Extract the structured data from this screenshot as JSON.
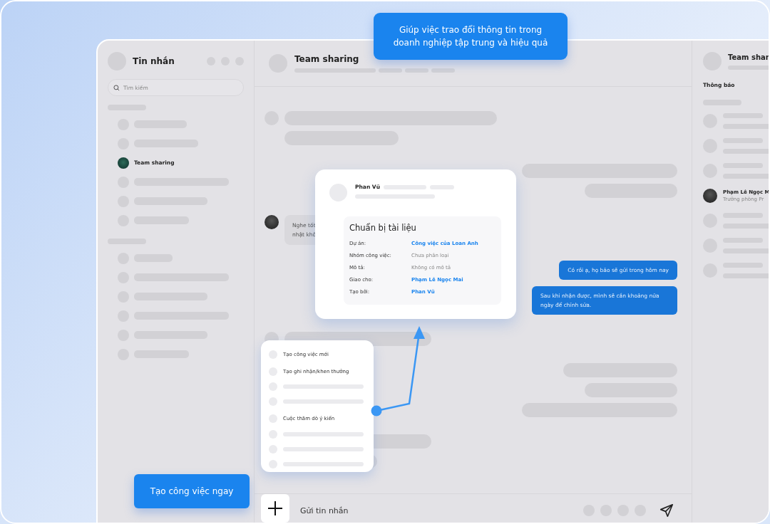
{
  "callout": "Giúp việc trao đổi thông tin trong doanh nghiệp tập trung và hiệu quả",
  "cta_button": "Tạo công việc ngay",
  "sidebar": {
    "title": "Tin nhắn",
    "search": {
      "placeholder": "Tìm kiếm"
    },
    "sections": [
      {
        "items": [
          {
            "kind": "placeholder"
          },
          {
            "kind": "placeholder"
          },
          {
            "kind": "chat",
            "name": "Team sharing"
          },
          {
            "kind": "placeholder"
          },
          {
            "kind": "placeholder"
          },
          {
            "kind": "placeholder"
          }
        ]
      },
      {
        "items": [
          {
            "kind": "placeholder"
          },
          {
            "kind": "placeholder"
          },
          {
            "kind": "placeholder"
          },
          {
            "kind": "placeholder"
          },
          {
            "kind": "placeholder"
          },
          {
            "kind": "placeholder"
          }
        ]
      }
    ]
  },
  "chat": {
    "title": "Team sharing",
    "messages": [
      {
        "kind": "placeholder_in"
      },
      {
        "kind": "placeholder_in_cont"
      },
      {
        "kind": "placeholder_out"
      },
      {
        "kind": "placeholder_out"
      },
      {
        "kind": "in",
        "lines": [
          "Nghe tốt",
          "nhật khô"
        ]
      },
      {
        "kind": "out",
        "text": "Có rồi ạ, họ bảo sẽ gửi trong hôm nay"
      },
      {
        "kind": "out",
        "text": "Sau khi nhận được, mình sẽ cần khoảng nửa ngày để chỉnh sửa."
      },
      {
        "kind": "placeholder_in"
      },
      {
        "kind": "placeholder_out"
      },
      {
        "kind": "placeholder_out"
      },
      {
        "kind": "placeholder_out"
      },
      {
        "kind": "placeholder_in_cont"
      },
      {
        "kind": "placeholder_in_cont"
      }
    ],
    "composer": {
      "placeholder": "Gửi tin nhắn"
    }
  },
  "task_card": {
    "author": "Phan Vũ",
    "title": "Chuẩn bị tài liệu",
    "fields": [
      {
        "label": "Dự án:",
        "value": "Công việc của Loan Anh",
        "link": true
      },
      {
        "label": "Nhóm công việc:",
        "value": "Chưa phân loại",
        "link": false
      },
      {
        "label": "Mô tả:",
        "value": "Không có mô tả",
        "link": false
      },
      {
        "label": "Giao cho:",
        "value": "Phạm Lê Ngọc Mai",
        "link": true
      },
      {
        "label": "Tạo bởi:",
        "value": "Phan Vũ",
        "link": true
      }
    ]
  },
  "action_menu": {
    "items": [
      {
        "kind": "action",
        "label": "Tạo công việc mới"
      },
      {
        "kind": "action",
        "label": "Tạo ghi nhận/khen thưởng"
      },
      {
        "kind": "placeholder"
      },
      {
        "kind": "placeholder"
      },
      {
        "kind": "action",
        "label": "Cuộc thăm dò ý kiến"
      },
      {
        "kind": "placeholder"
      },
      {
        "kind": "placeholder"
      },
      {
        "kind": "placeholder"
      }
    ]
  },
  "info_panel": {
    "title": "Team shar",
    "section": "Thông báo",
    "members": [
      {
        "kind": "placeholder"
      },
      {
        "kind": "placeholder"
      },
      {
        "kind": "placeholder"
      },
      {
        "kind": "member",
        "name": "Phạm Lê Ngọc M",
        "role": "Trưởng phòng Pr"
      },
      {
        "kind": "placeholder"
      },
      {
        "kind": "placeholder"
      },
      {
        "kind": "placeholder"
      }
    ]
  }
}
